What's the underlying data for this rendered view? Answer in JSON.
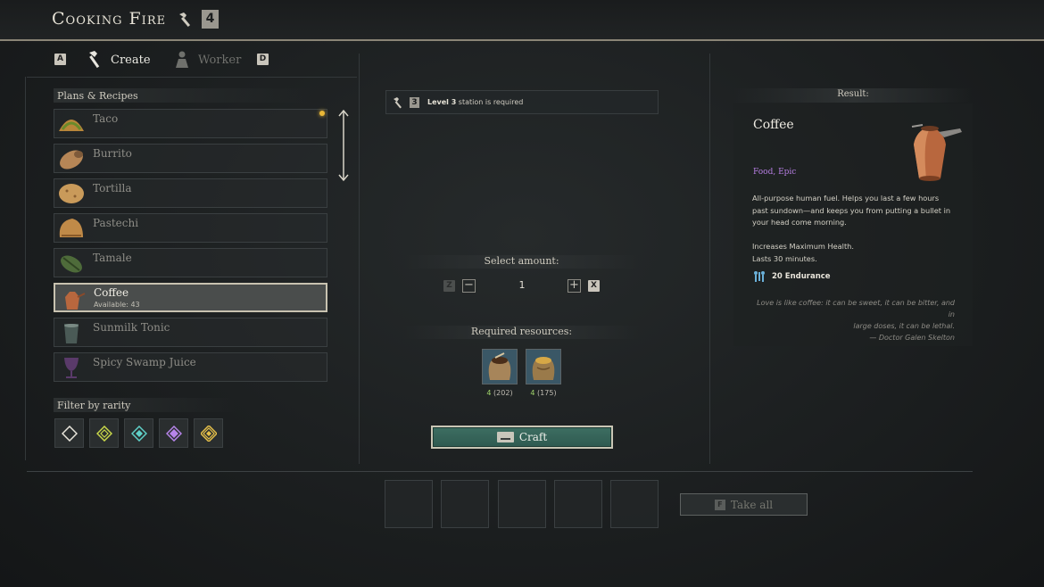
{
  "header": {
    "title": "Cooking Fire",
    "station_level": "4"
  },
  "tabs": {
    "prev_key": "A",
    "create_label": "Create",
    "worker_label": "Worker",
    "next_key": "D"
  },
  "recipes": {
    "title": "Plans & Recipes",
    "items": [
      {
        "name": "Taco",
        "new": true
      },
      {
        "name": "Burrito"
      },
      {
        "name": "Tortilla"
      },
      {
        "name": "Pastechi"
      },
      {
        "name": "Tamale"
      },
      {
        "name": "Coffee",
        "available": "Available: 43",
        "selected": true
      },
      {
        "name": "Sunmilk Tonic"
      },
      {
        "name": "Spicy Swamp Juice"
      }
    ]
  },
  "filter": {
    "title": "Filter by rarity",
    "colors": [
      "#e9e6dc",
      "#c9d84a",
      "#5fd0c8",
      "#b784ea",
      "#e6c04a"
    ]
  },
  "requirement": {
    "level": "3",
    "bold": "Level 3",
    "text": " station is required"
  },
  "amount": {
    "title": "Select amount:",
    "min_key": "Z",
    "value": "1",
    "max_key": "X"
  },
  "resources": {
    "title": "Required resources:",
    "items": [
      {
        "need": "4",
        "have": " (202)"
      },
      {
        "need": "4",
        "have": " (175)"
      }
    ]
  },
  "craft": {
    "label": "Craft"
  },
  "take_all": {
    "key": "F",
    "label": "Take all"
  },
  "result": {
    "title": "Result:",
    "name": "Coffee",
    "type": "Food, Epic",
    "description": "All-purpose human fuel. Helps you last a few hours past sundown—and keeps you from putting a bullet in your head come morning.",
    "effect_line1": "Increases Maximum Health.",
    "effect_line2": "Lasts 30 minutes.",
    "stat": "20 Endurance",
    "quote_line1": "Love is like coffee: it can be sweet, it can be bitter, and in",
    "quote_line2": "large doses, it can be lethal.",
    "quote_author": "— Doctor Galen Skelton"
  }
}
